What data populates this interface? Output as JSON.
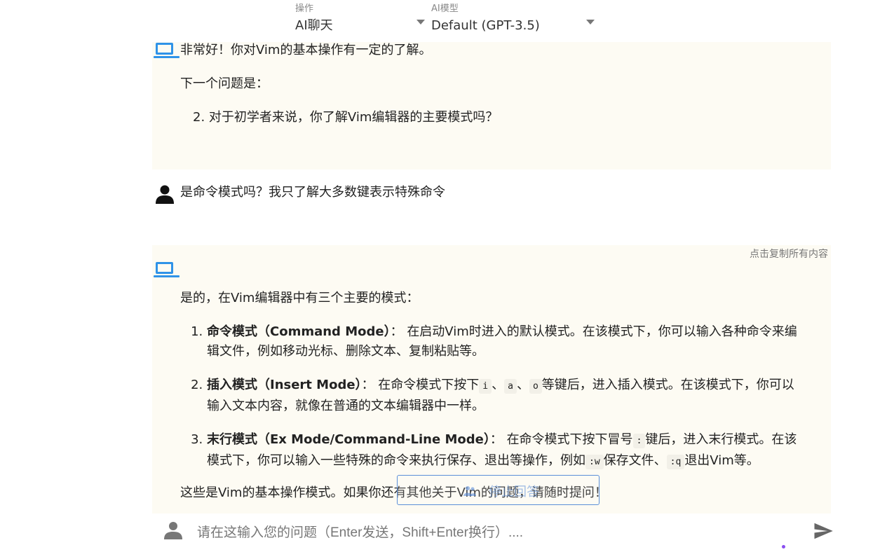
{
  "toolbar": {
    "operation": {
      "label": "操作",
      "value": "AI聊天"
    },
    "model": {
      "label": "AI模型",
      "value": "Default (GPT-3.5)"
    }
  },
  "messages": {
    "first_ai": {
      "line1": "非常好！你对Vim的基本操作有一定的了解。",
      "line2": "下一个问题是：",
      "item_number": "2.",
      "item_text": "对于初学者来说，你了解Vim编辑器的主要模式吗？"
    },
    "user": {
      "text": "是命令模式吗？我只了解大多数键表示特殊命令"
    },
    "second_ai": {
      "copy_all": "点击复制所有内容",
      "intro": "是的，在Vim编辑器中有三个主要的模式：",
      "modes": [
        {
          "title": "命令模式（Command Mode）",
          "sep": "：",
          "text": "在启动Vim时进入的默认模式。在该模式下，你可以输入各种命令来编辑文件，例如移动光标、删除文本、复制粘贴等。"
        },
        {
          "title": "插入模式（Insert Mode）",
          "sep": "：",
          "pre": "在命令模式下按下",
          "key1": "i",
          "comma1": "、",
          "key2": "a",
          "comma2": "、",
          "key3": "o",
          "post": "等键后，进入插入模式。在该模式下，你可以输入文本内容，就像在普通的文本编辑器中一样。"
        },
        {
          "title": "末行模式（Ex Mode/Command-Line Mode）",
          "sep": "：",
          "pre": "在命令模式下按下冒号",
          "key1": ":",
          "mid": "键后，进入末行模式。在该模式下，你可以输入一些特殊的命令来执行保存、退出等操作，例如",
          "key2": ":w",
          "mid2": "保存文件、",
          "key3": ":q",
          "post": "退出Vim等。"
        }
      ],
      "outro": "这些是Vim的基本操作模式。如果你还有其他关于Vim的问题，请随时提问！"
    }
  },
  "overlay": {
    "label": "停止回答"
  },
  "input": {
    "placeholder": "请在这输入您的问题（Enter发送，Shift+Enter换行）...."
  },
  "colors": {
    "ai_bg": "#fdfbf3",
    "ai_icon": "#2f93e8",
    "overlay_border": "#5b8fd8",
    "dot": "#8a4ef0"
  }
}
